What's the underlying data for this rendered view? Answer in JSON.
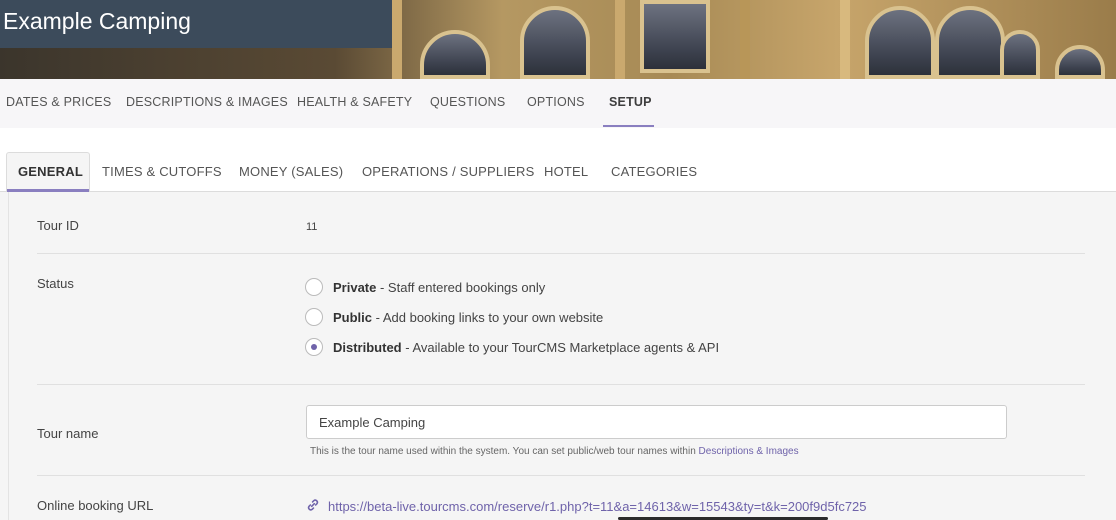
{
  "header": {
    "title": "Example Camping"
  },
  "top_tabs": [
    {
      "label": "DATES & PRICES"
    },
    {
      "label": "DESCRIPTIONS & IMAGES"
    },
    {
      "label": "HEALTH & SAFETY"
    },
    {
      "label": "QUESTIONS"
    },
    {
      "label": "OPTIONS"
    },
    {
      "label": "SETUP",
      "active": true
    }
  ],
  "sub_tabs": [
    {
      "label": "GENERAL",
      "active": true
    },
    {
      "label": "TIMES & CUTOFFS"
    },
    {
      "label": "MONEY (SALES)"
    },
    {
      "label": "OPERATIONS / SUPPLIERS"
    },
    {
      "label": "HOTEL"
    },
    {
      "label": "CATEGORIES"
    }
  ],
  "form": {
    "tour_id": {
      "label": "Tour ID",
      "value": "11"
    },
    "status": {
      "label": "Status",
      "options": [
        {
          "name": "Private",
          "desc": " - Staff entered bookings only",
          "checked": false
        },
        {
          "name": "Public",
          "desc": " - Add booking links to your own website",
          "checked": false
        },
        {
          "name": "Distributed",
          "desc": " - Available to your TourCMS Marketplace agents & API",
          "checked": true
        }
      ]
    },
    "tour_name": {
      "label": "Tour name",
      "value": "Example Camping",
      "help": "This is the tour name used within the system. You can set public/web tour names within ",
      "help_link": "Descriptions & Images"
    },
    "booking_url": {
      "label": "Online booking URL",
      "value": "https://beta-live.tourcms.com/reserve/r1.php?t=11&a=14613&w=15543&ty=t&k=200f9d5fc725",
      "icon": "link-icon"
    }
  },
  "colors": {
    "accent": "#6f63aa",
    "title_bg": "#3c4b5b"
  }
}
